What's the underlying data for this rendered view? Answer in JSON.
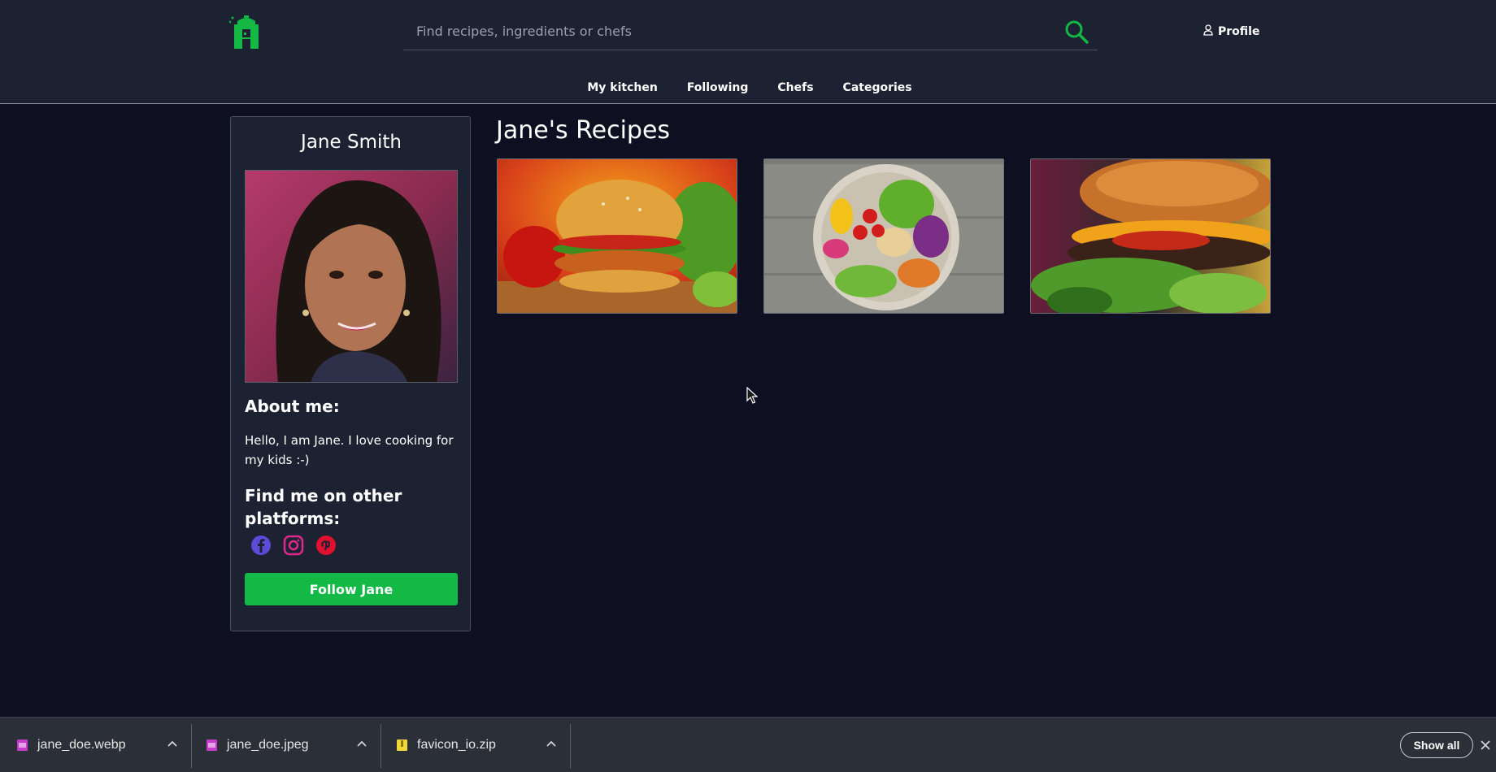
{
  "header": {
    "search": {
      "placeholder": "Find recipes, ingredients or chefs"
    },
    "profile_label": "Profile",
    "nav": [
      "My kitchen",
      "Following",
      "Chefs",
      "Categories"
    ]
  },
  "profile": {
    "name": "Jane Smith",
    "about_heading": "About me:",
    "about_text": "Hello, I am Jane. I love cooking for my kids :-)",
    "platforms_heading": "Find me on other platforms:",
    "socials": [
      "facebook-icon",
      "instagram-icon",
      "pinterest-icon"
    ],
    "follow_label": "Follow Jane"
  },
  "recipes": {
    "title": "Jane's Recipes"
  },
  "downloads": {
    "items": [
      "jane_doe.webp",
      "jane_doe.jpeg",
      "favicon_io.zip"
    ],
    "show_all": "Show all"
  },
  "colors": {
    "accent": "#14b845",
    "background": "#0e1022",
    "header": "#1c2232",
    "download_bar": "#2b2f38"
  }
}
